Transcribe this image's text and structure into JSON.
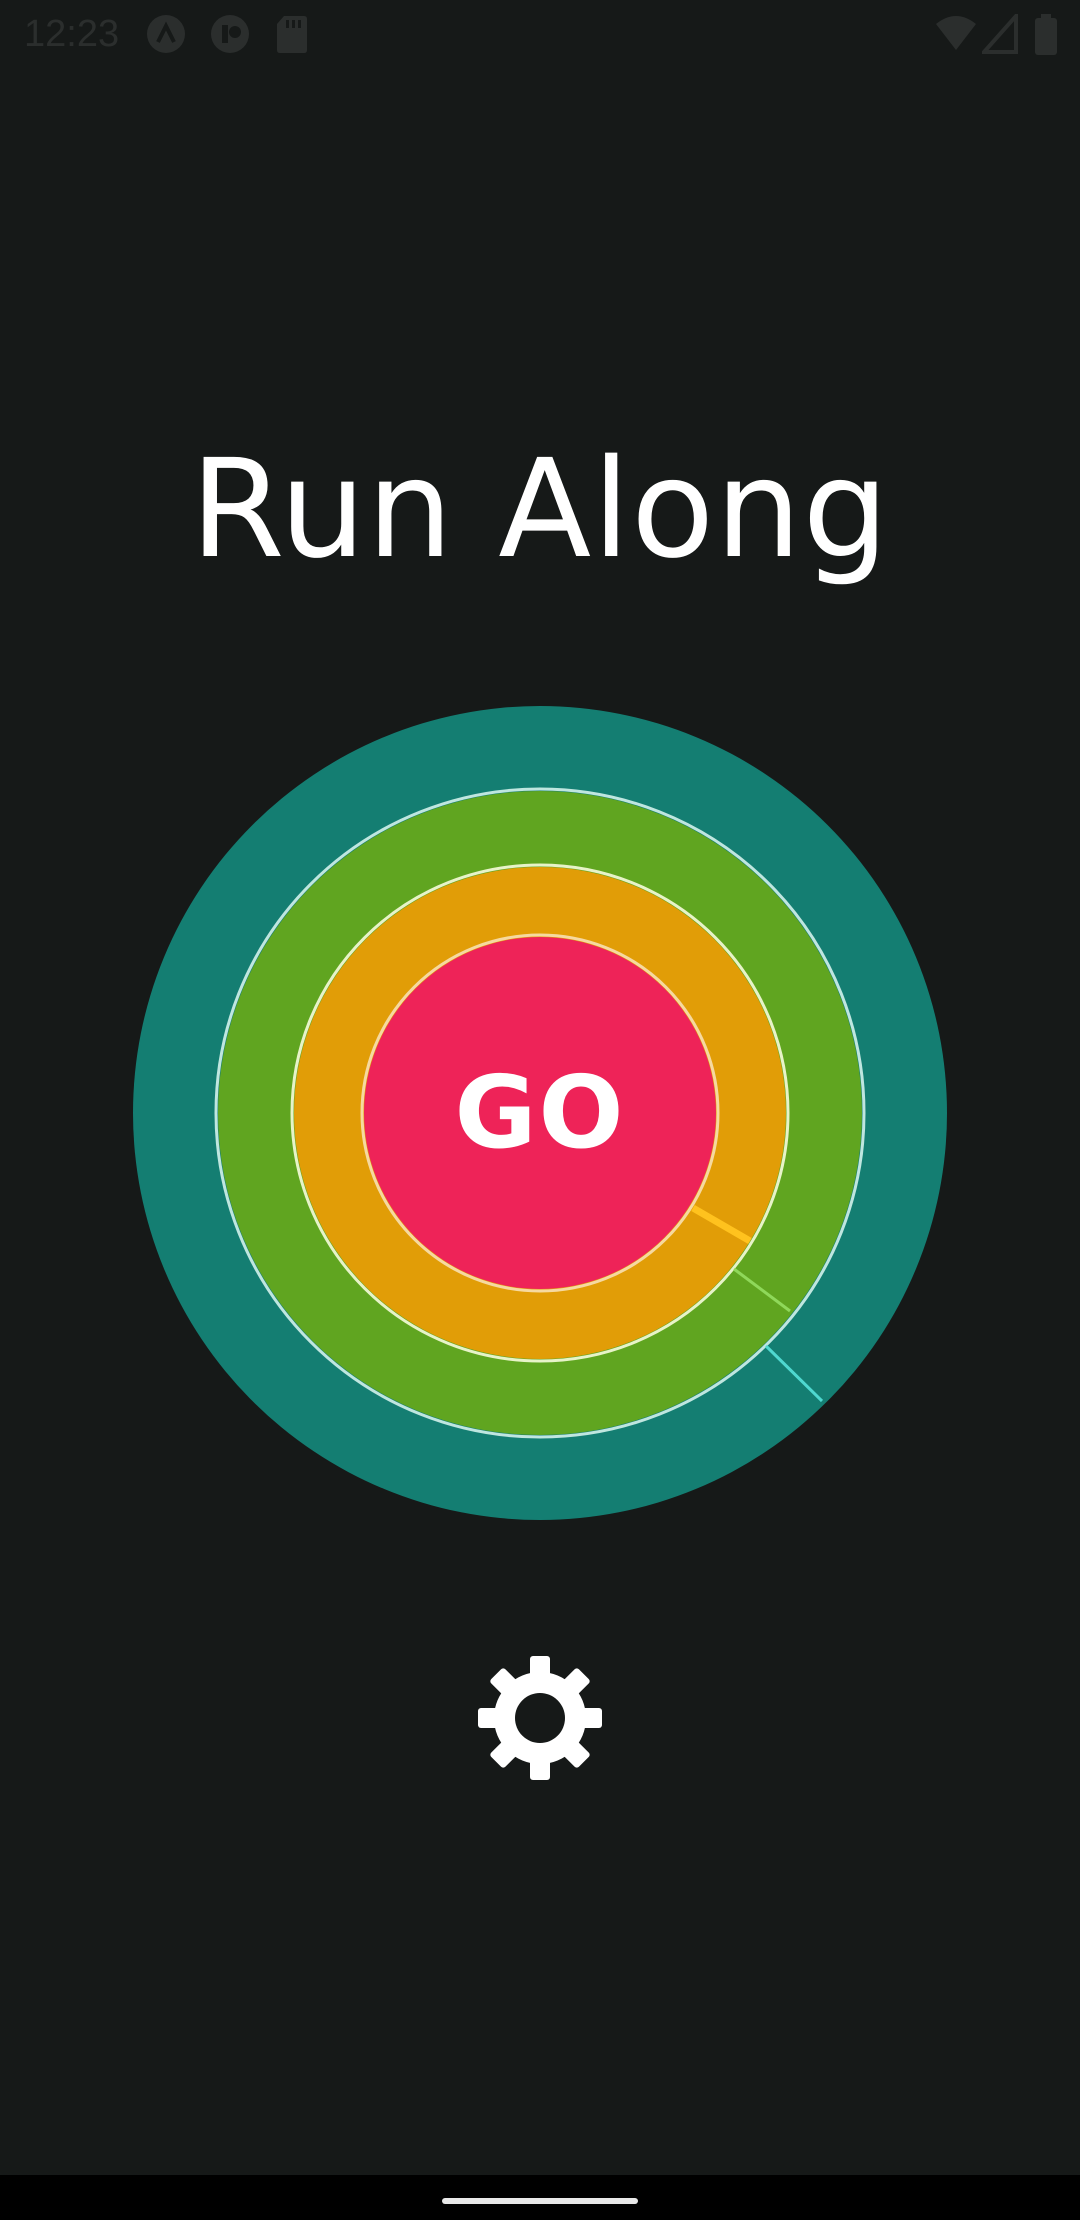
{
  "status_bar": {
    "time": "12:23",
    "left_icons": [
      "app-notification-icon",
      "app-notification-icon",
      "sd-card-icon"
    ],
    "right_icons": [
      "wifi-icon",
      "signal-icon",
      "battery-icon"
    ]
  },
  "app": {
    "title": "Run Along"
  },
  "go_button": {
    "label": "GO",
    "color": "#ee2358"
  },
  "rings": [
    {
      "name": "outer-ring",
      "color": "#147e72",
      "marker_color": "#4fd8d0"
    },
    {
      "name": "middle-ring",
      "color": "#60a520",
      "marker_color": "#8fd85a"
    },
    {
      "name": "inner-ring",
      "color": "#e19d07",
      "marker_color": "#ffc21e"
    }
  ],
  "settings": {
    "icon": "gear-icon",
    "color": "#ffffff"
  },
  "nav_bar": {
    "handle": "home-handle"
  }
}
